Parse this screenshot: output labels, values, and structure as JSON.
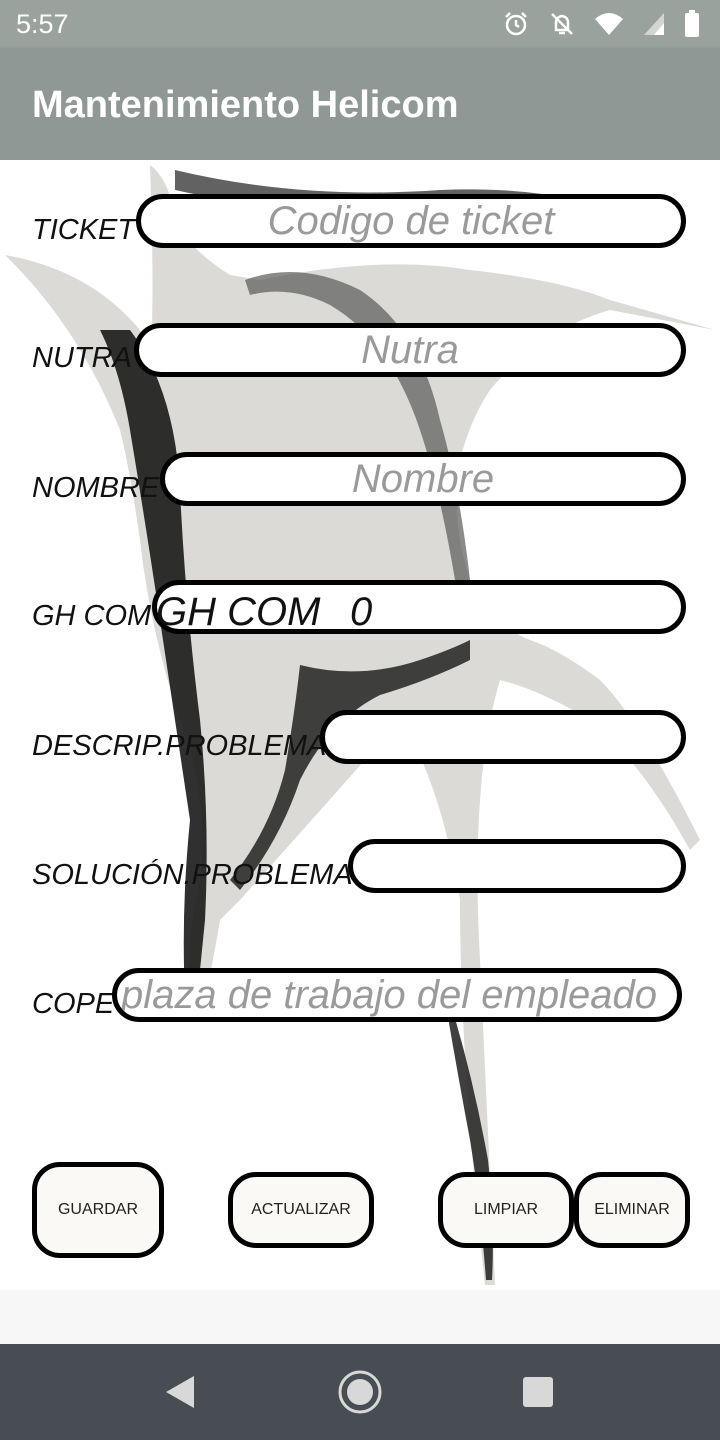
{
  "status_bar": {
    "time": "5:57",
    "icons": [
      "alarm-icon",
      "notifications-off-icon",
      "wifi-icon",
      "signal-icon",
      "battery-icon"
    ]
  },
  "app_bar": {
    "title": "Mantenimiento Helicom"
  },
  "form": {
    "ticket": {
      "label": "TICKET",
      "placeholder": "Codigo de ticket",
      "value": ""
    },
    "nutra": {
      "label": "NUTRA",
      "placeholder": "Nutra",
      "value": ""
    },
    "nombre": {
      "label": "NOMBRE",
      "placeholder": "Nombre",
      "value": ""
    },
    "gh_com": {
      "label": "GH COM",
      "value": "GH COM",
      "number": "0"
    },
    "descrip": {
      "label": "DESCRIP.PROBLEMA",
      "value": ""
    },
    "solucion": {
      "label": "SOLUCIÓN.PROBLEMA",
      "value": ""
    },
    "cope": {
      "label": "COPE",
      "placeholder": "plaza de trabajo del empleado",
      "value": ""
    }
  },
  "buttons": {
    "guardar": "GUARDAR",
    "actualizar": "ACTUALIZAR",
    "limpiar": "LIMPIAR",
    "eliminar": "ELIMINAR"
  },
  "nav_bar": {
    "icons": [
      "back-icon",
      "home-icon",
      "recents-icon"
    ]
  },
  "colors": {
    "status_bar": "#9aa29e",
    "app_bar": "#909896",
    "nav_bar": "#474d52",
    "input_border": "#000000",
    "placeholder": "#9a9a9a"
  }
}
